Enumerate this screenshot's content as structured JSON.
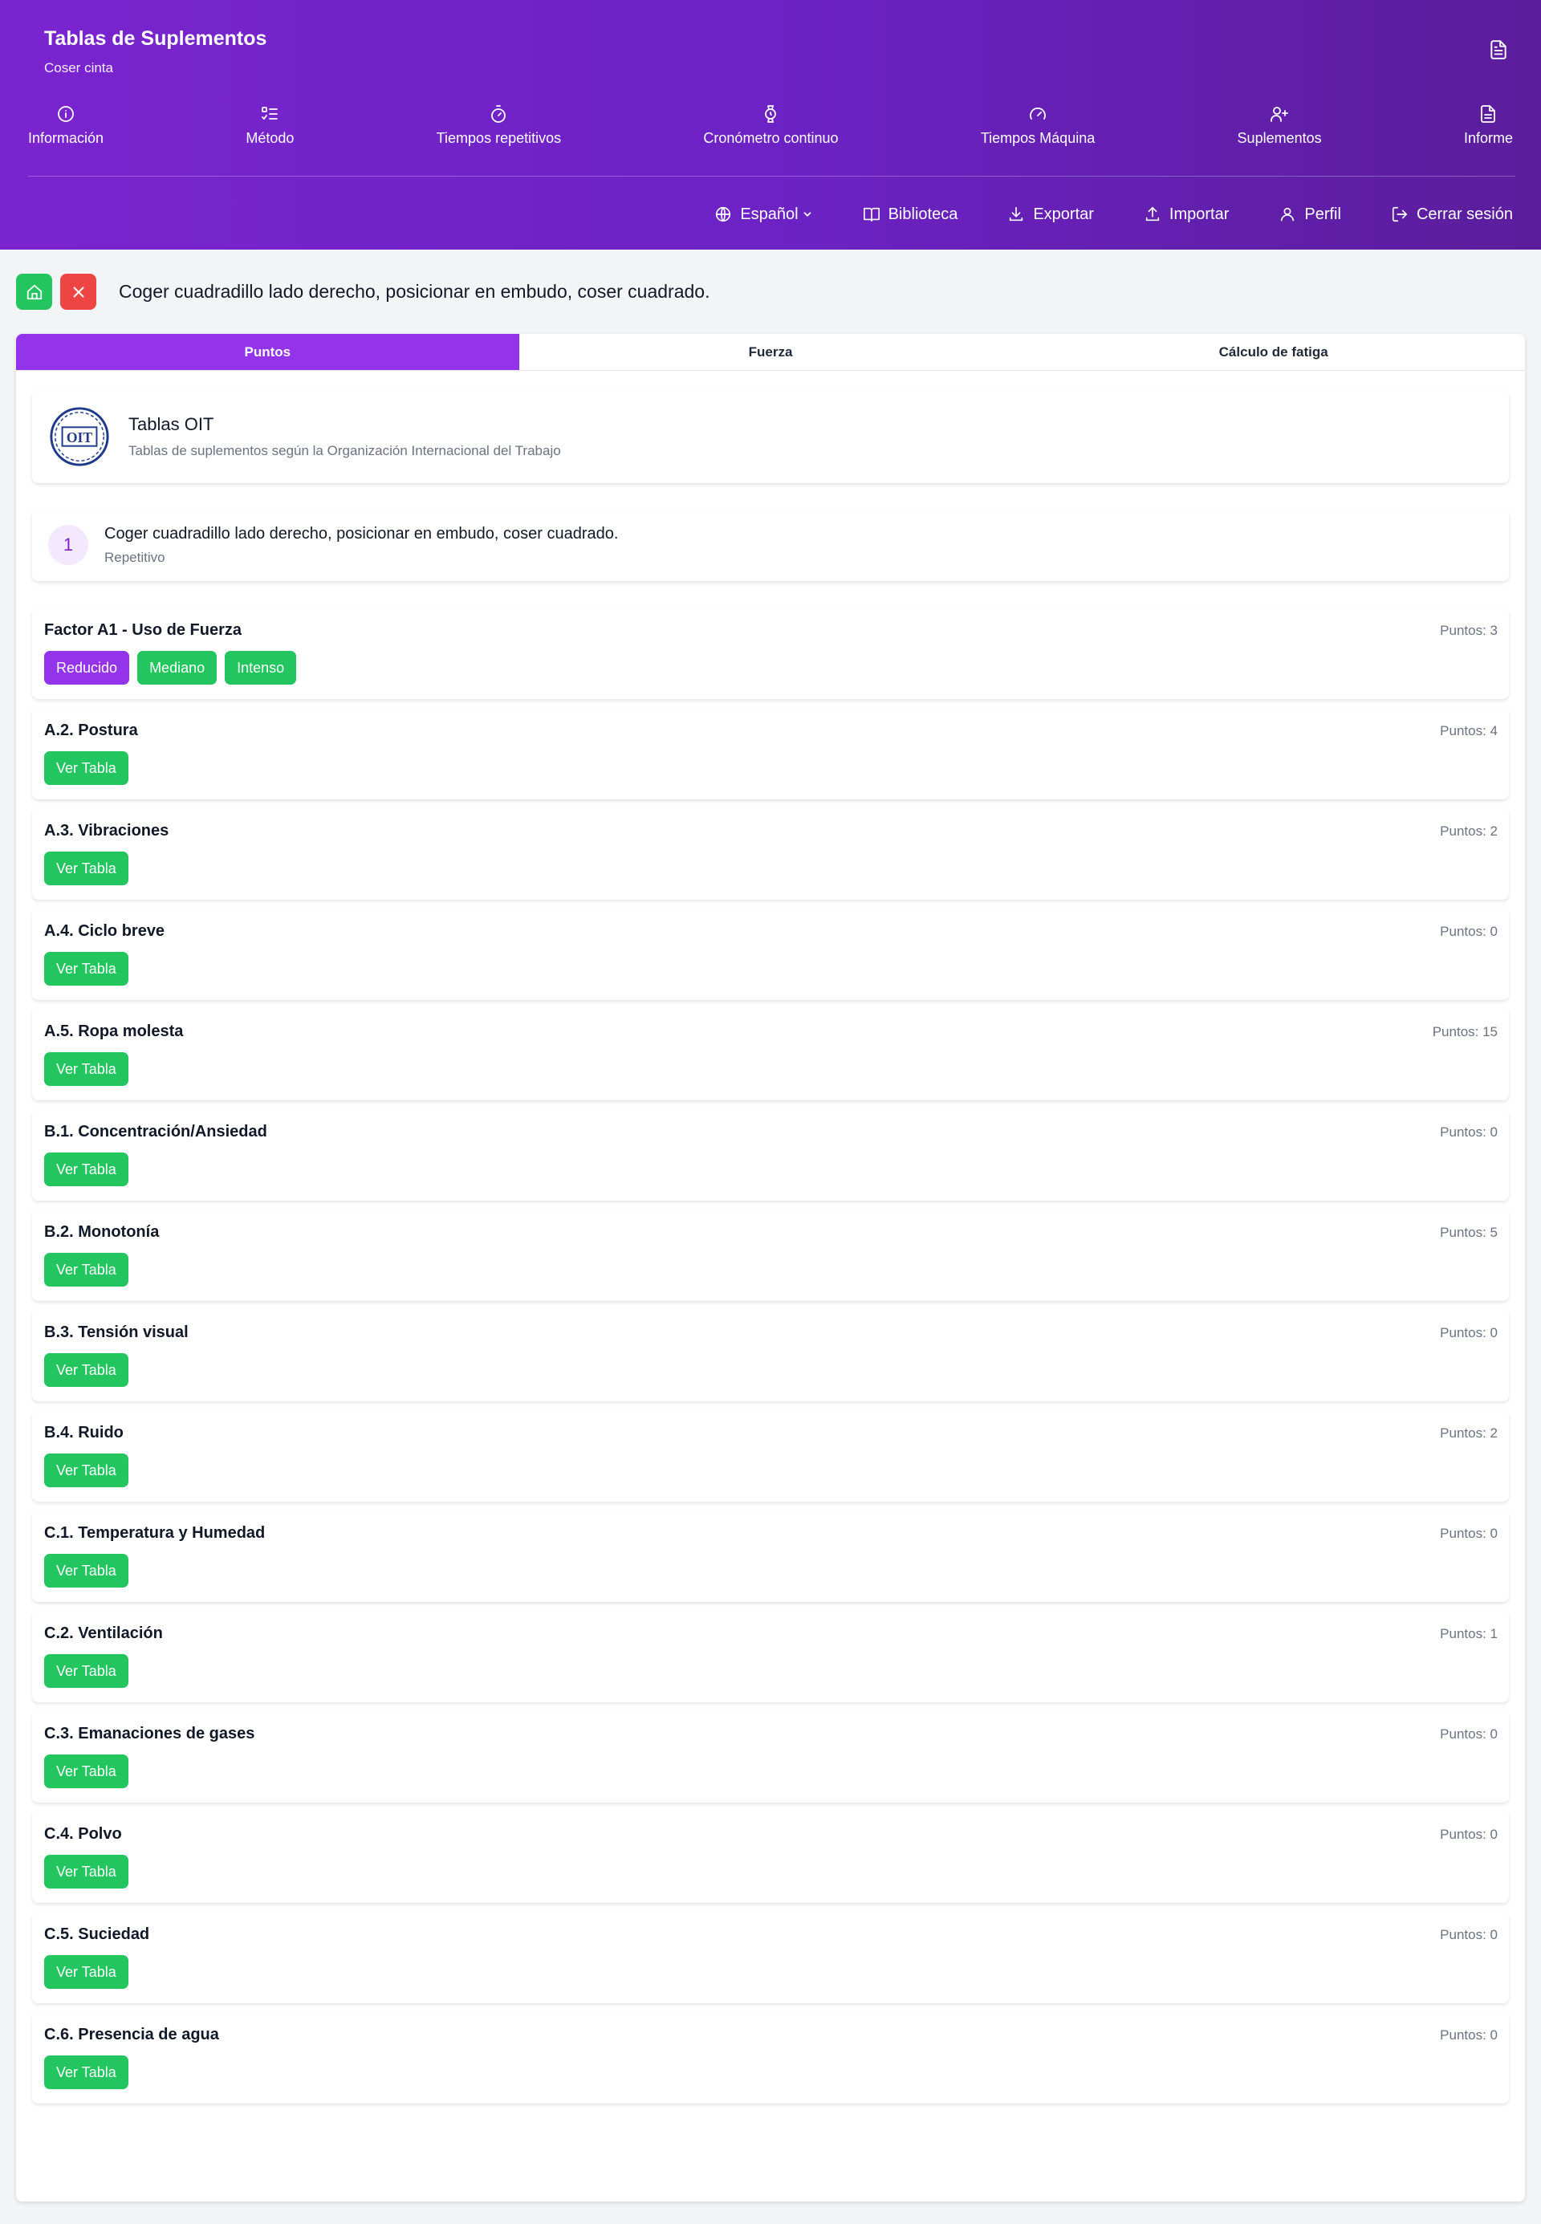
{
  "header": {
    "title": "Tablas de Suplementos",
    "subtitle": "Coser cinta",
    "nav": [
      {
        "label": "Información",
        "icon": "info-icon"
      },
      {
        "label": "Método",
        "icon": "list-check-icon"
      },
      {
        "label": "Tiempos repetitivos",
        "icon": "timer-icon"
      },
      {
        "label": "Cronómetro continuo",
        "icon": "watch-icon"
      },
      {
        "label": "Tiempos Máquina",
        "icon": "gauge-icon"
      },
      {
        "label": "Suplementos",
        "icon": "user-plus-icon"
      },
      {
        "label": "Informe",
        "icon": "document-icon"
      }
    ],
    "actions": {
      "language": "Español",
      "library": "Biblioteca",
      "export": "Exportar",
      "import": "Importar",
      "profile": "Perfil",
      "logout": "Cerrar sesión"
    }
  },
  "task_title": "Coger cuadradillo lado derecho, posicionar en embudo, coser cuadrado.",
  "tabs": [
    "Puntos",
    "Fuerza",
    "Cálculo de fatiga"
  ],
  "active_tab": "Puntos",
  "oit": {
    "title": "Tablas OIT",
    "subtitle": "Tablas de suplementos según la Organización Internacional del Trabajo"
  },
  "task_card": {
    "number": "1",
    "name": "Coger cuadradillo lado derecho, posicionar en embudo, coser cuadrado.",
    "type": "Repetitivo"
  },
  "factors": [
    {
      "name": "Factor A1 - Uso de Fuerza",
      "points": "Puntos: 3",
      "options": [
        {
          "label": "Reducido",
          "selected": true
        },
        {
          "label": "Mediano",
          "selected": false
        },
        {
          "label": "Intenso",
          "selected": false
        }
      ]
    },
    {
      "name": "A.2. Postura",
      "points": "Puntos: 4",
      "button": "Ver Tabla"
    },
    {
      "name": "A.3. Vibraciones",
      "points": "Puntos: 2",
      "button": "Ver Tabla"
    },
    {
      "name": "A.4. Ciclo breve",
      "points": "Puntos: 0",
      "button": "Ver Tabla"
    },
    {
      "name": "A.5. Ropa molesta",
      "points": "Puntos: 15",
      "button": "Ver Tabla"
    },
    {
      "name": "B.1. Concentración/Ansiedad",
      "points": "Puntos: 0",
      "button": "Ver Tabla"
    },
    {
      "name": "B.2. Monotonía",
      "points": "Puntos: 5",
      "button": "Ver Tabla"
    },
    {
      "name": "B.3. Tensión visual",
      "points": "Puntos: 0",
      "button": "Ver Tabla"
    },
    {
      "name": "B.4. Ruido",
      "points": "Puntos: 2",
      "button": "Ver Tabla"
    },
    {
      "name": "C.1. Temperatura y Humedad",
      "points": "Puntos: 0",
      "button": "Ver Tabla"
    },
    {
      "name": "C.2. Ventilación",
      "points": "Puntos: 1",
      "button": "Ver Tabla"
    },
    {
      "name": "C.3. Emanaciones de gases",
      "points": "Puntos: 0",
      "button": "Ver Tabla"
    },
    {
      "name": "C.4. Polvo",
      "points": "Puntos: 0",
      "button": "Ver Tabla"
    },
    {
      "name": "C.5. Suciedad",
      "points": "Puntos: 0",
      "button": "Ver Tabla"
    },
    {
      "name": "C.6. Presencia de agua",
      "points": "Puntos: 0",
      "button": "Ver Tabla"
    }
  ],
  "colors": {
    "header_start": "#7a24cf",
    "header_end": "#5b1d9c",
    "accent_purple": "#9333ea",
    "green": "#22c55e",
    "red": "#ef4444"
  }
}
